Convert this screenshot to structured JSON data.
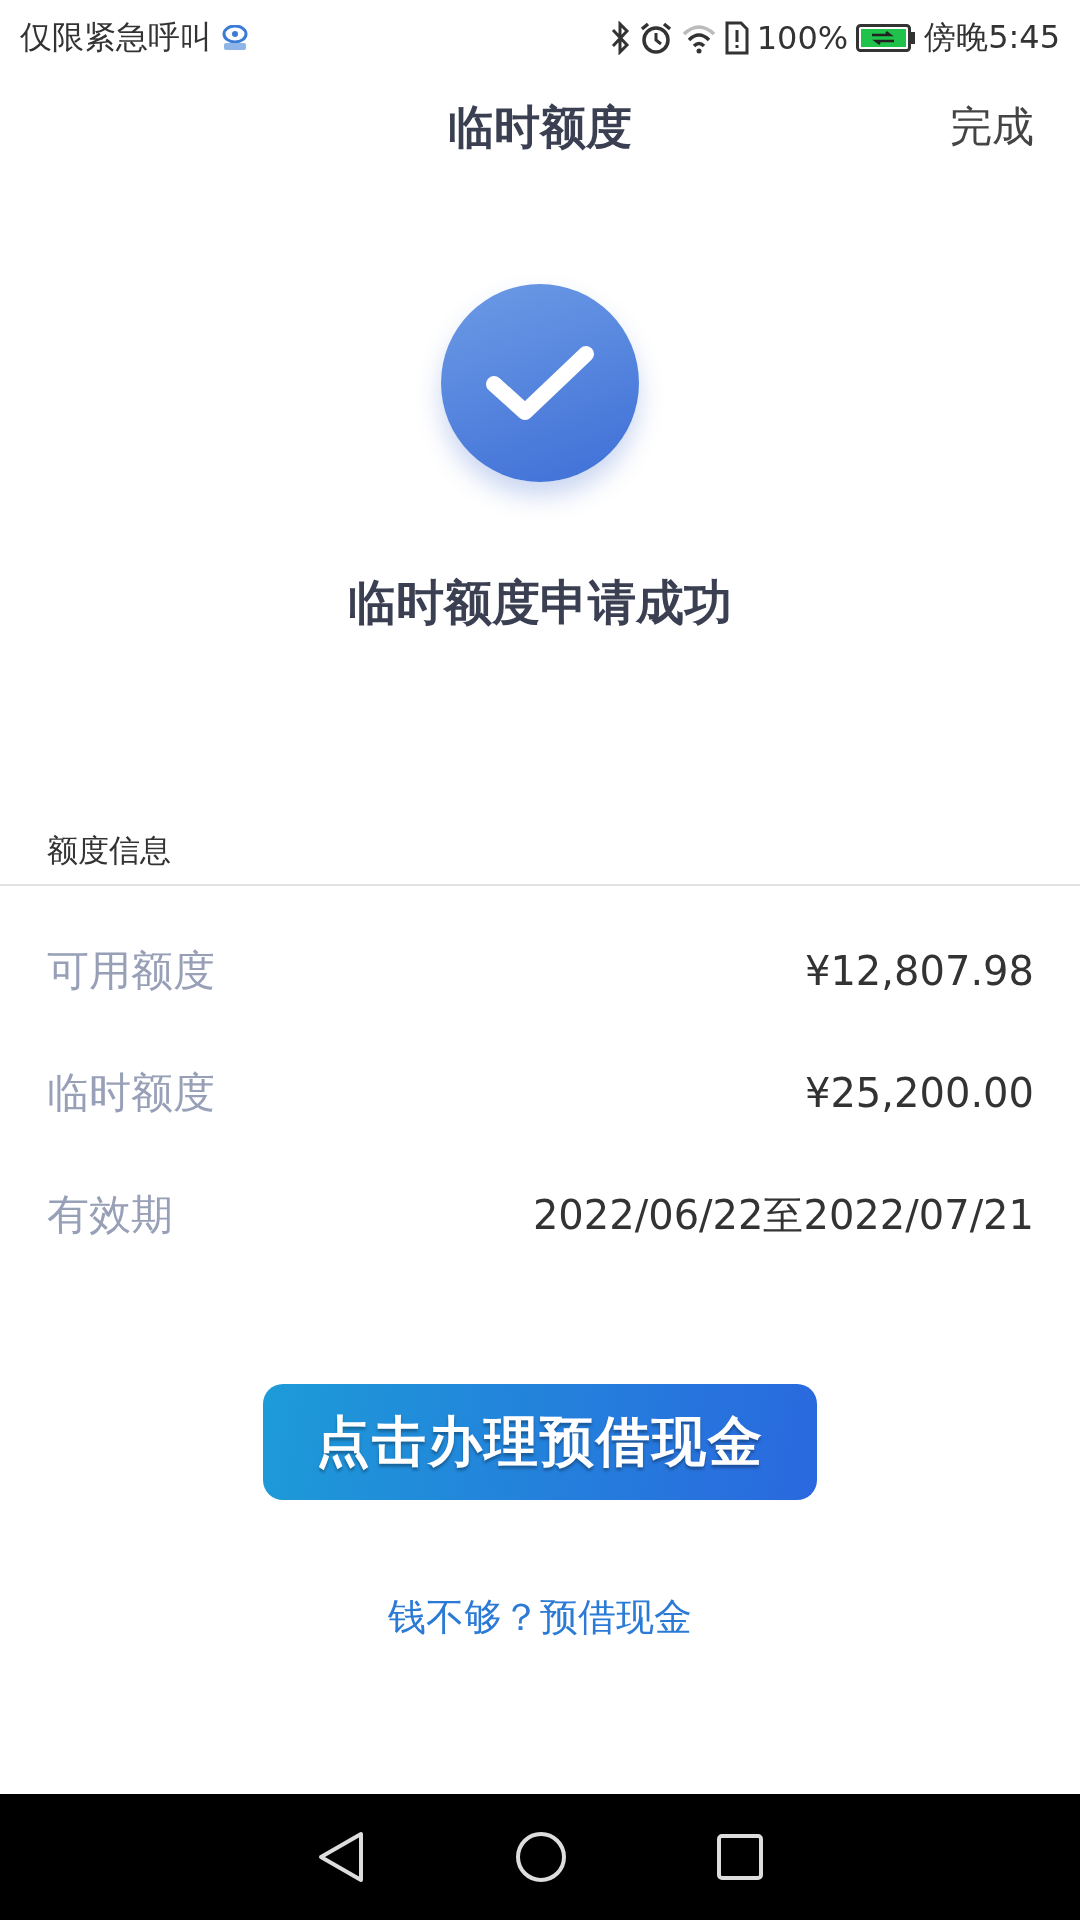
{
  "status_bar": {
    "carrier": "仅限紧急呼叫",
    "battery": "100%",
    "time": "傍晚5:45"
  },
  "header": {
    "title": "临时额度",
    "action": "完成"
  },
  "result": {
    "message": "临时额度申请成功"
  },
  "info": {
    "section_title": "额度信息",
    "rows": [
      {
        "label": "可用额度",
        "value": "¥12,807.98"
      },
      {
        "label": "临时额度",
        "value": "¥25,200.00"
      },
      {
        "label": "有效期",
        "value": "2022/06/22至2022/07/21"
      }
    ]
  },
  "primary_button": "点击办理预借现金",
  "link": "钱不够？预借现金"
}
